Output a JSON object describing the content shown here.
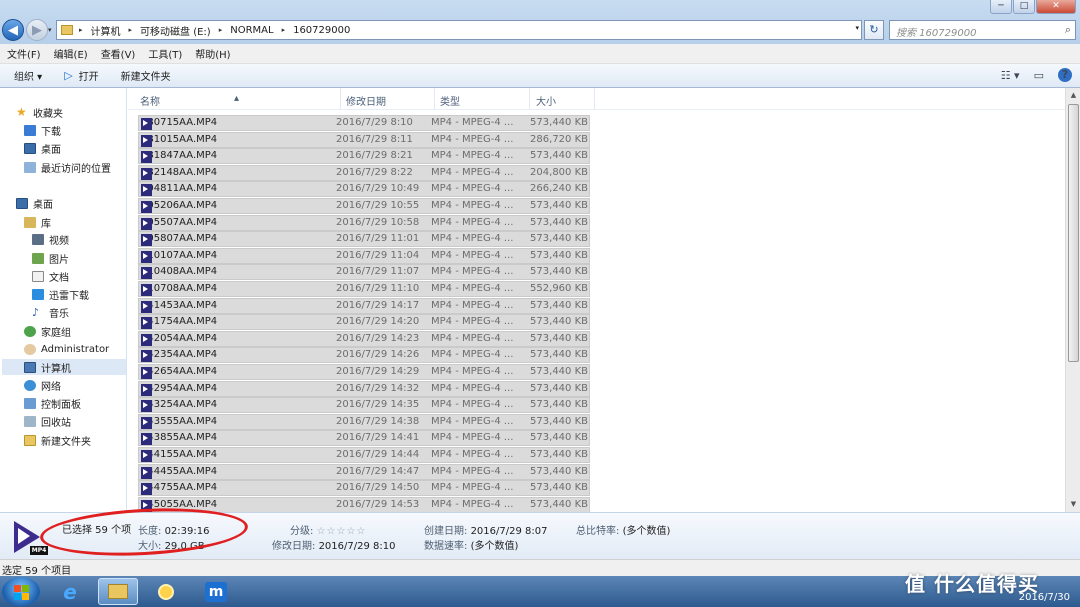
{
  "window": {
    "minimize": "─",
    "maximize": "□",
    "close": "✕"
  },
  "nav": {
    "back": "◀",
    "forward": "▶",
    "dropdown": "▾"
  },
  "address": {
    "crumbs": [
      "计算机",
      "可移动磁盘 (E:)",
      "NORMAL",
      "160729000"
    ],
    "separator": "▸",
    "dropdown": "▾",
    "refresh": "↻"
  },
  "search": {
    "placeholder": "搜索 160729000",
    "icon": "⌕"
  },
  "menu": [
    "文件(F)",
    "编辑(E)",
    "查看(V)",
    "工具(T)",
    "帮助(H)"
  ],
  "toolbar": {
    "organize": "组织 ▾",
    "open": "打开",
    "open_icon": "▷",
    "new_folder": "新建文件夹",
    "view_icon": "☷ ▾",
    "preview_icon": "▭",
    "help_icon": "?"
  },
  "sidebar": [
    {
      "label": "收藏夹",
      "icon": "star",
      "glyph": "★"
    },
    {
      "label": "下载",
      "icon": "dl"
    },
    {
      "label": "桌面",
      "icon": "desk"
    },
    {
      "label": "最近访问的位置",
      "icon": "recent"
    },
    {
      "label": "桌面",
      "icon": "desk"
    },
    {
      "label": "库",
      "icon": "lib"
    },
    {
      "label": "视频",
      "icon": "video"
    },
    {
      "label": "图片",
      "icon": "pic"
    },
    {
      "label": "文档",
      "icon": "doc"
    },
    {
      "label": "迅雷下载",
      "icon": "thunder"
    },
    {
      "label": "音乐",
      "icon": "music",
      "glyph": "♪"
    },
    {
      "label": "家庭组",
      "icon": "home"
    },
    {
      "label": "Administrator",
      "icon": "user"
    },
    {
      "label": "计算机",
      "icon": "pc",
      "selected": true
    },
    {
      "label": "网络",
      "icon": "net"
    },
    {
      "label": "控制面板",
      "icon": "cp"
    },
    {
      "label": "回收站",
      "icon": "bin"
    },
    {
      "label": "新建文件夹",
      "icon": "folder"
    }
  ],
  "columns": {
    "name": "名称",
    "date": "修改日期",
    "type": "类型",
    "size": "大小",
    "sort_icon": "▴"
  },
  "files": [
    [
      "080715AA.MP4",
      "2016/7/29 8:10",
      "MP4 - MPEG-4 ...",
      "573,440 KB"
    ],
    [
      "081015AA.MP4",
      "2016/7/29 8:11",
      "MP4 - MPEG-4 ...",
      "286,720 KB"
    ],
    [
      "081847AA.MP4",
      "2016/7/29 8:21",
      "MP4 - MPEG-4 ...",
      "573,440 KB"
    ],
    [
      "082148AA.MP4",
      "2016/7/29 8:22",
      "MP4 - MPEG-4 ...",
      "204,800 KB"
    ],
    [
      "104811AA.MP4",
      "2016/7/29 10:49",
      "MP4 - MPEG-4 ...",
      "266,240 KB"
    ],
    [
      "105206AA.MP4",
      "2016/7/29 10:55",
      "MP4 - MPEG-4 ...",
      "573,440 KB"
    ],
    [
      "105507AA.MP4",
      "2016/7/29 10:58",
      "MP4 - MPEG-4 ...",
      "573,440 KB"
    ],
    [
      "105807AA.MP4",
      "2016/7/29 11:01",
      "MP4 - MPEG-4 ...",
      "573,440 KB"
    ],
    [
      "110107AA.MP4",
      "2016/7/29 11:04",
      "MP4 - MPEG-4 ...",
      "573,440 KB"
    ],
    [
      "110408AA.MP4",
      "2016/7/29 11:07",
      "MP4 - MPEG-4 ...",
      "573,440 KB"
    ],
    [
      "110708AA.MP4",
      "2016/7/29 11:10",
      "MP4 - MPEG-4 ...",
      "552,960 KB"
    ],
    [
      "141453AA.MP4",
      "2016/7/29 14:17",
      "MP4 - MPEG-4 ...",
      "573,440 KB"
    ],
    [
      "141754AA.MP4",
      "2016/7/29 14:20",
      "MP4 - MPEG-4 ...",
      "573,440 KB"
    ],
    [
      "142054AA.MP4",
      "2016/7/29 14:23",
      "MP4 - MPEG-4 ...",
      "573,440 KB"
    ],
    [
      "142354AA.MP4",
      "2016/7/29 14:26",
      "MP4 - MPEG-4 ...",
      "573,440 KB"
    ],
    [
      "142654AA.MP4",
      "2016/7/29 14:29",
      "MP4 - MPEG-4 ...",
      "573,440 KB"
    ],
    [
      "142954AA.MP4",
      "2016/7/29 14:32",
      "MP4 - MPEG-4 ...",
      "573,440 KB"
    ],
    [
      "143254AA.MP4",
      "2016/7/29 14:35",
      "MP4 - MPEG-4 ...",
      "573,440 KB"
    ],
    [
      "143555AA.MP4",
      "2016/7/29 14:38",
      "MP4 - MPEG-4 ...",
      "573,440 KB"
    ],
    [
      "143855AA.MP4",
      "2016/7/29 14:41",
      "MP4 - MPEG-4 ...",
      "573,440 KB"
    ],
    [
      "144155AA.MP4",
      "2016/7/29 14:44",
      "MP4 - MPEG-4 ...",
      "573,440 KB"
    ],
    [
      "144455AA.MP4",
      "2016/7/29 14:47",
      "MP4 - MPEG-4 ...",
      "573,440 KB"
    ],
    [
      "144755AA.MP4",
      "2016/7/29 14:50",
      "MP4 - MPEG-4 ...",
      "573,440 KB"
    ],
    [
      "145055AA.MP4",
      "2016/7/29 14:53",
      "MP4 - MPEG-4 ...",
      "573,440 KB"
    ]
  ],
  "details": {
    "icon_badge": "MP4",
    "selected": "已选择 59 个项",
    "length_label": "长度:",
    "length": "02:39:16",
    "size_label": "大小:",
    "size": "29.0 GB",
    "rating_label": "分级:",
    "stars": "☆☆☆☆☆",
    "modified_label": "修改日期:",
    "modified": "2016/7/29 8:10",
    "created_label": "创建日期:",
    "created": "2016/7/29 8:07",
    "datarate_label": "数据速率:",
    "datarate": "(多个数值)",
    "bitrate_label": "总比特率:",
    "bitrate": "(多个数值)"
  },
  "status": "选定 59 个项目",
  "taskbar": {
    "ie": "e",
    "maxthon": "m",
    "clock": "2016/7/30"
  },
  "watermark": "值 什么值得买",
  "colors": {
    "selection_row": "#dbdbdb",
    "annotation": "#e02020",
    "taskbar": "#2d5a8f"
  }
}
